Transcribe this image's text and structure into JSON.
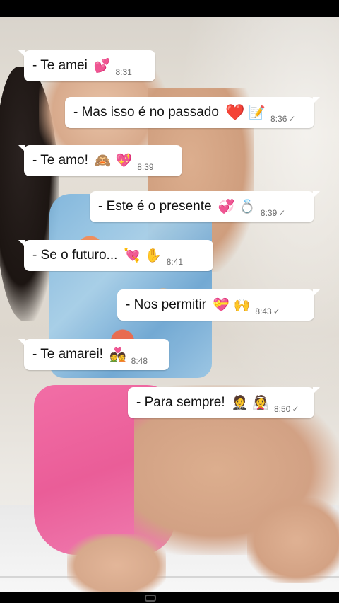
{
  "messages": [
    {
      "side": "in",
      "text": "- Te amei",
      "emojis": [
        "💕"
      ],
      "time": "8:31",
      "ticks": ""
    },
    {
      "side": "out",
      "text": "- Mas isso é no passado",
      "emojis": [
        "❤️",
        "📝"
      ],
      "time": "8:36",
      "ticks": "✓"
    },
    {
      "side": "in",
      "text": "-  Te amo!",
      "emojis": [
        "🙈",
        "💖"
      ],
      "time": "8:39",
      "ticks": ""
    },
    {
      "side": "out",
      "text": "- Este é o presente",
      "emojis": [
        "💞",
        "💍"
      ],
      "time": "8:39",
      "ticks": "✓"
    },
    {
      "side": "in",
      "text": "-  Se o futuro...",
      "emojis": [
        "💘",
        "✋"
      ],
      "time": "8:41",
      "ticks": ""
    },
    {
      "side": "out",
      "text": "- Nos permitir",
      "emojis": [
        "💝",
        "🙌"
      ],
      "time": "8:43",
      "ticks": "✓"
    },
    {
      "side": "in",
      "text": "- Te amarei!",
      "emojis": [
        "💑"
      ],
      "time": "8:48",
      "ticks": ""
    },
    {
      "side": "out",
      "text": "- Para sempre!",
      "emojis": [
        "🤵",
        "👰"
      ],
      "time": "8:50",
      "ticks": "✓"
    }
  ]
}
